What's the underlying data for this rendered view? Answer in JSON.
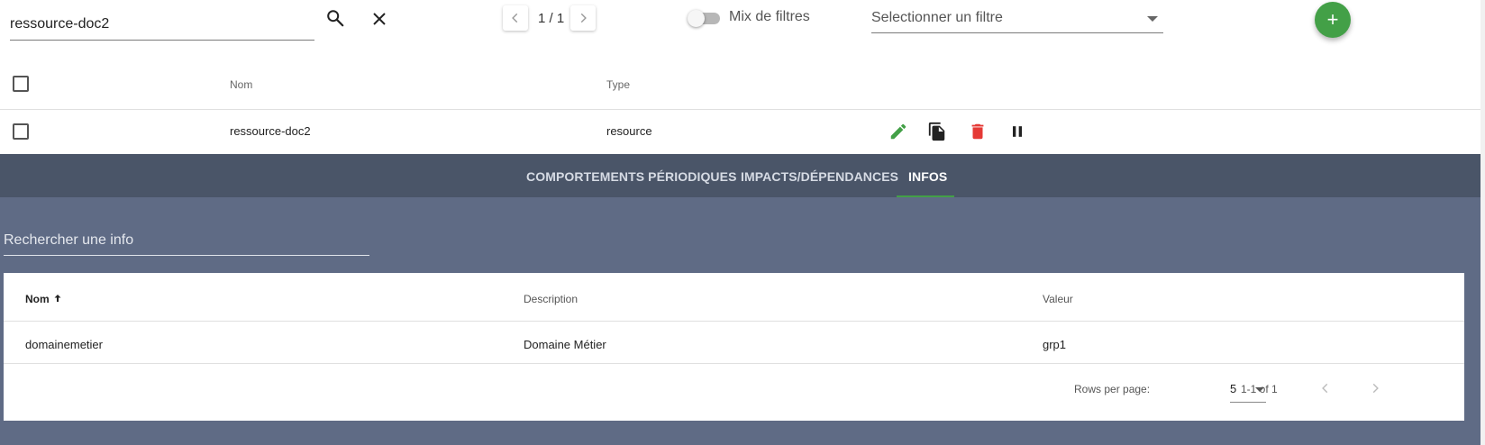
{
  "toolbar": {
    "search_value": "ressource-doc2",
    "search_icon": "search-icon",
    "clear_icon": "close-icon",
    "pager_text": "1 / 1",
    "mix_filters_label": "Mix de filtres",
    "mix_filters_on": false,
    "filter_placeholder": "Selectionner un filtre",
    "add_label": "+"
  },
  "table": {
    "headers": {
      "name": "Nom",
      "type": "Type"
    },
    "rows": [
      {
        "name": "ressource-doc2",
        "type": "resource",
        "actions": [
          "edit-icon",
          "duplicate-icon",
          "delete-icon",
          "pause-icon"
        ]
      }
    ]
  },
  "expanded": {
    "tabs": [
      {
        "label": "COMPORTEMENTS PÉRIODIQUES",
        "active": false
      },
      {
        "label": "IMPACTS/DÉPENDANCES",
        "active": false
      },
      {
        "label": "INFOS",
        "active": true
      }
    ],
    "info_search_placeholder": "Rechercher une info",
    "info_table": {
      "headers": {
        "name": "Nom",
        "description": "Description",
        "value": "Valeur"
      },
      "sort": {
        "column": "name",
        "direction": "asc"
      },
      "rows": [
        {
          "name": "domainemetier",
          "description": "Domaine Métier",
          "value": "grp1"
        }
      ],
      "footer": {
        "rows_per_page_label": "Rows per page:",
        "rows_per_page_value": "5",
        "range_text": "1-1 of 1"
      }
    }
  },
  "colors": {
    "accent_green": "#43a047",
    "delete_red": "#e53935",
    "panel_bg": "#5f6b85",
    "tabbar_bg": "#4a5568"
  }
}
